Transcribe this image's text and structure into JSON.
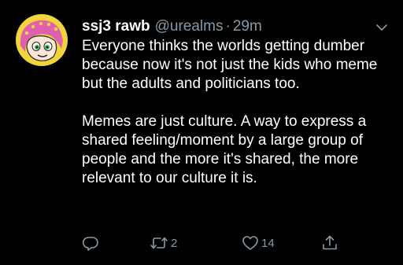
{
  "tweet": {
    "display_name": "ssj3 rawb",
    "handle": "@urealms",
    "separator": "·",
    "timestamp": "29m",
    "body": [
      "Everyone thinks the worlds getting dumber because now it's not just the kids who meme but the adults and politicians too.",
      "Memes are just culture. A way to express a shared feeling/moment by a large group of people and the more it's shared, the more relevant to our culture it is."
    ],
    "actions": {
      "reply": {
        "icon": "reply-icon",
        "count": ""
      },
      "retweet": {
        "icon": "retweet-icon",
        "count": "2"
      },
      "like": {
        "icon": "heart-icon",
        "count": "14"
      },
      "share": {
        "icon": "share-icon",
        "count": ""
      }
    },
    "menu_icon": "chevron-down-icon",
    "avatar_icon": "avatar"
  },
  "colors": {
    "background": "#000000",
    "text_primary": "#ffffff",
    "text_secondary": "#8899a6",
    "avatar_yellow": "#f2d43c",
    "avatar_hair": "#e060b0",
    "avatar_eyes": "#3cb44a"
  }
}
